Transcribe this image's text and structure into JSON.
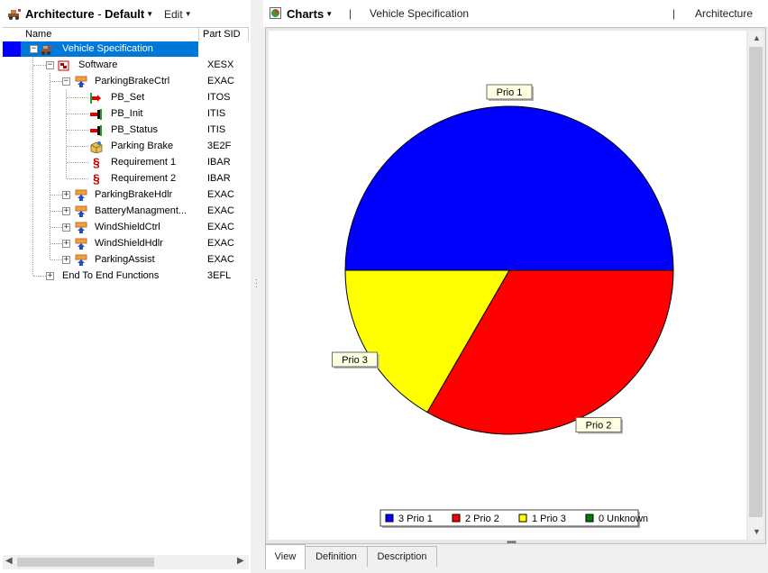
{
  "left_toolbar": {
    "title": "Architecture",
    "separator": "-",
    "view": "Default",
    "edit": "Edit"
  },
  "tree_header": {
    "name": "Name",
    "part_sid": "Part SID"
  },
  "tree": [
    {
      "label": "Vehicle Specification",
      "sid": "",
      "icon": "vehicle-spec-icon",
      "level": 0,
      "expander": "minus",
      "selected": true
    },
    {
      "label": "Software",
      "sid": "XESX",
      "icon": "software-icon",
      "level": 1,
      "expander": "minus"
    },
    {
      "label": "ParkingBrakeCtrl",
      "sid": "EXAC",
      "icon": "component-icon",
      "level": 2,
      "expander": "minus"
    },
    {
      "label": "PB_Set",
      "sid": "ITOS",
      "icon": "port-out-icon",
      "level": 3,
      "expander": ""
    },
    {
      "label": "PB_Init",
      "sid": "ITIS",
      "icon": "port-in-icon",
      "level": 3,
      "expander": ""
    },
    {
      "label": "PB_Status",
      "sid": "ITIS",
      "icon": "port-in-icon",
      "level": 3,
      "expander": ""
    },
    {
      "label": "Parking Brake",
      "sid": "3E2F",
      "icon": "feature-box-icon",
      "level": 3,
      "expander": ""
    },
    {
      "label": "Requirement 1",
      "sid": "IBAR",
      "icon": "requirement-icon",
      "level": 3,
      "expander": ""
    },
    {
      "label": "Requirement 2",
      "sid": "IBAR",
      "icon": "requirement-icon",
      "level": 3,
      "expander": ""
    },
    {
      "label": "ParkingBrakeHdlr",
      "sid": "EXAC",
      "icon": "component-icon",
      "level": 2,
      "expander": "plus"
    },
    {
      "label": "BatteryManagment...",
      "sid": "EXAC",
      "icon": "component-icon",
      "level": 2,
      "expander": "plus"
    },
    {
      "label": "WindShieldCtrl",
      "sid": "EXAC",
      "icon": "component-icon",
      "level": 2,
      "expander": "plus"
    },
    {
      "label": "WindShieldHdlr",
      "sid": "EXAC",
      "icon": "component-icon",
      "level": 2,
      "expander": "plus"
    },
    {
      "label": "ParkingAssist",
      "sid": "EXAC",
      "icon": "component-icon",
      "level": 2,
      "expander": "plus"
    },
    {
      "label": "End To End Functions",
      "sid": "3EFL",
      "icon": "",
      "level": 1,
      "expander": "plus"
    }
  ],
  "right_toolbar": {
    "charts": "Charts",
    "separator": "|",
    "context": "Vehicle Specification",
    "perspective": "Architecture"
  },
  "chart_data": {
    "type": "pie",
    "slices": [
      {
        "name": "Prio 1",
        "value": 3,
        "color": "#0000ff"
      },
      {
        "name": "Prio 2",
        "value": 2,
        "color": "#ff0000"
      },
      {
        "name": "Prio 3",
        "value": 1,
        "color": "#ffff00"
      },
      {
        "name": "Unknown",
        "value": 0,
        "color": "#008000"
      }
    ],
    "legend": [
      "3 Prio 1",
      "2 Prio 2",
      "1 Prio 3",
      "0 Unknown"
    ],
    "legend_position": "bottom"
  },
  "tabs": [
    "View",
    "Definition",
    "Description"
  ],
  "active_tab": "View",
  "colors": {
    "selection": "#0078d7",
    "selection_marker": "#0000ff"
  }
}
